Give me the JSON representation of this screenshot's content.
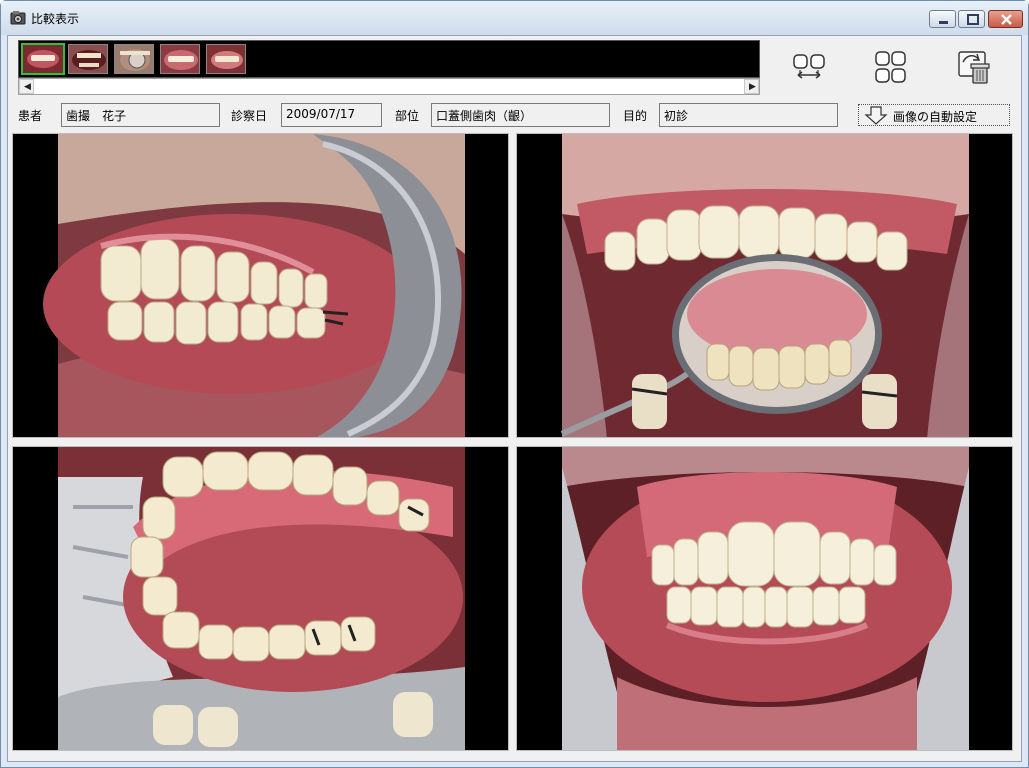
{
  "window": {
    "title": "比較表示",
    "icons": {
      "app": "camera-app-icon",
      "minimize": "minimize-icon",
      "maximize": "maximize-icon",
      "close": "close-icon"
    }
  },
  "thumbnails": [
    {
      "label": "front-smile",
      "selected": true
    },
    {
      "label": "retractor-open",
      "selected": false
    },
    {
      "label": "mirror-view",
      "selected": false
    },
    {
      "label": "lips-smile",
      "selected": false
    },
    {
      "label": "closed-smile",
      "selected": false
    }
  ],
  "toolbar": {
    "tools": [
      {
        "icon": "swap-compare-icon"
      },
      {
        "icon": "four-grid-icon"
      },
      {
        "icon": "recycle-delete-icon"
      }
    ]
  },
  "fields": {
    "patient": {
      "label": "患者",
      "value": "歯撮　花子"
    },
    "exam_date": {
      "label": "診察日",
      "value": "2009/07/17"
    },
    "region": {
      "label": "部位",
      "value": "口蓋側歯肉（齦）"
    },
    "purpose": {
      "label": "目的",
      "value": "初診"
    }
  },
  "auto_set_button": {
    "label": "画像の自動設定",
    "icon": "down-arrow-icon"
  },
  "panels": [
    {
      "name": "photo-right-lateral"
    },
    {
      "name": "photo-upper-occlusal-mirror"
    },
    {
      "name": "photo-lower-lateral-open"
    },
    {
      "name": "photo-frontal-retracted"
    }
  ],
  "colors": {
    "selected_thumb": "#2fbf3a",
    "strip_bg": "#000000",
    "gum": "#c8606a",
    "tooth": "#f3ead2"
  }
}
